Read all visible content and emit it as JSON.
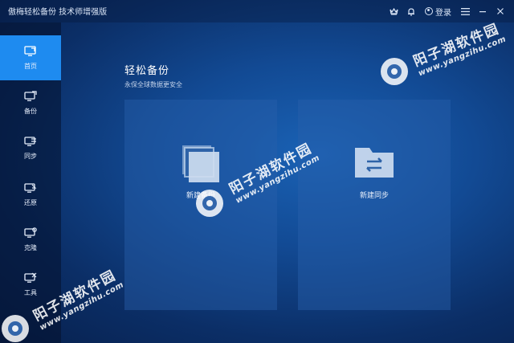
{
  "app": {
    "title": "傲梅轻松备份 技术师增强版"
  },
  "titlebar": {
    "icons": [
      "crown-icon",
      "bell-icon",
      "user-icon",
      "menu-icon"
    ],
    "login_label": "登录"
  },
  "sidebar": {
    "items": [
      {
        "label": "首页",
        "icon": "monitor-home-icon",
        "active": true
      },
      {
        "label": "备份",
        "icon": "monitor-backup-icon",
        "active": false
      },
      {
        "label": "同步",
        "icon": "monitor-sync-icon",
        "active": false
      },
      {
        "label": "还原",
        "icon": "monitor-restore-icon",
        "active": false
      },
      {
        "label": "克隆",
        "icon": "monitor-clone-icon",
        "active": false
      },
      {
        "label": "工具",
        "icon": "monitor-tools-icon",
        "active": false
      }
    ]
  },
  "main": {
    "title": "轻松备份",
    "subtitle": "永保全球数据更安全",
    "cards": [
      {
        "label": "新建备份",
        "icon": "copy-stack-icon"
      },
      {
        "label": "新建同步",
        "icon": "folder-sync-icon"
      }
    ]
  },
  "watermarks": [
    {
      "name": "阳子湖软件园",
      "url": "www.yangzihu.com"
    },
    {
      "name": "阳子湖软件园",
      "url": "www.yangzihu.com"
    },
    {
      "name": "阳子湖软件园",
      "url": "www.yangzihu.com"
    }
  ],
  "colors": {
    "accent": "#1e8bf0",
    "background": "#124a94",
    "card": "#2860aa"
  }
}
